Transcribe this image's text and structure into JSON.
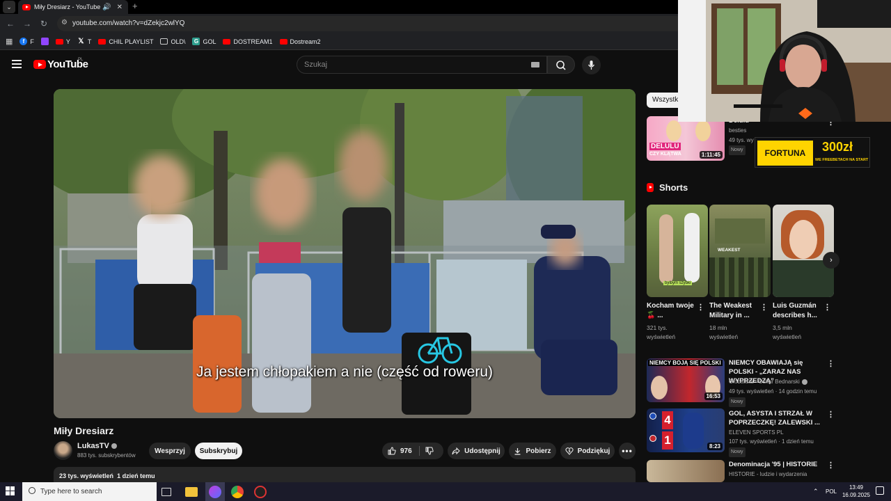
{
  "browser": {
    "tab_title": "Miły Dresiarz - YouTube",
    "url": "youtube.com/watch?v=dZekjc2wlYQ",
    "bookmarks": [
      {
        "label": "F",
        "color": "#1877f2"
      },
      {
        "label": "",
        "color": "#9146ff"
      },
      {
        "label": "Y",
        "color": "#ff0000"
      },
      {
        "label": "T",
        "color": "#000000"
      },
      {
        "label": "CHIL PLAYLIST",
        "color": "#ff0000"
      },
      {
        "label": "OLD\\",
        "color": "folder"
      },
      {
        "label": "GOL",
        "color": "#2e9e8e"
      },
      {
        "label": "DOSTREAM1",
        "color": "#ff0000"
      },
      {
        "label": "Dostream2",
        "color": "#ff0000"
      }
    ]
  },
  "header": {
    "logo_text": "YouTube",
    "country": "PL",
    "search_placeholder": "Szukaj"
  },
  "video": {
    "subtitle": "Ja jestem chłopakiem a nie (część od roweru)",
    "title": "Miły Dresiarz",
    "channel": "LukasTV",
    "subscribers": "883 tys. subskrybentów",
    "support_label": "Wesprzyj",
    "subscribe_label": "Subskrybuj",
    "likes": "976",
    "share_label": "Udostępnij",
    "download_label": "Pobierz",
    "thanks_label": "Podziękuj",
    "views": "23 tys. wyświetleń",
    "age": "1 dzień temu"
  },
  "sidebar": {
    "chip_label": "Wszystki",
    "top_item": {
      "title": "Delulu czy klątwa?",
      "channel": "besties",
      "views_prefix": "49 tys. wy",
      "badge": "Nowy",
      "duration": "1:11:45",
      "thumb_text_1": "DELULU",
      "thumb_text_2": "CZY KLĄTWA"
    },
    "ad": {
      "brand": "FORTUNA",
      "amount": "300zł",
      "tagline": "WE FREEBETACH NA START"
    },
    "shorts_label": "Shorts",
    "shorts": [
      {
        "title": "Kocham twoje 🍒 ...",
        "views": "321 tys. wyświetleń",
        "overlay": "bylbym szybki"
      },
      {
        "title": "The Weakest Military in ...",
        "views": "18 mln wyświetleń",
        "overlay": "WEAKEST"
      },
      {
        "title": "Luis Guzmán describes h...",
        "views": "3,5 mln wyświetleń",
        "overlay": ""
      }
    ],
    "videos": [
      {
        "title": "NIEMCY OBAWIAJĄ się POLSKI - „ZARAZ NAS WYPRZEDZĄ”",
        "channel": "Globalista - Oskar Bednarski",
        "meta": "49 tys. wyświetleń · 14 godzin temu",
        "badge": "Nowy",
        "duration": "16:53",
        "thumb_text": "NIEMCY BOJĄ SIĘ POLSKI"
      },
      {
        "title": "GOL, ASYSTA I STRZAŁ W POPRZECZKĘ! ZALEWSKI ...",
        "channel": "ELEVEN SPORTS PL",
        "meta": "107 tys. wyświetleń · 1 dzień temu",
        "badge": "Nowy",
        "duration": "8:23",
        "score_top": "4",
        "score_bottom": "1"
      },
      {
        "title": "Denominacja '95 | HISTORIE",
        "channel": "HISTORIE - ludzie i wydarzenia",
        "meta": "",
        "badge": "",
        "duration": ""
      }
    ]
  },
  "taskbar": {
    "search_placeholder": "Type here to search",
    "language": "POL",
    "time": "13:49",
    "date": "16.09.2025"
  },
  "colors": {
    "accent": "#ff0000",
    "background": "#0f0f0f",
    "surface": "#272727",
    "fortuna_yellow": "#ffd400"
  }
}
